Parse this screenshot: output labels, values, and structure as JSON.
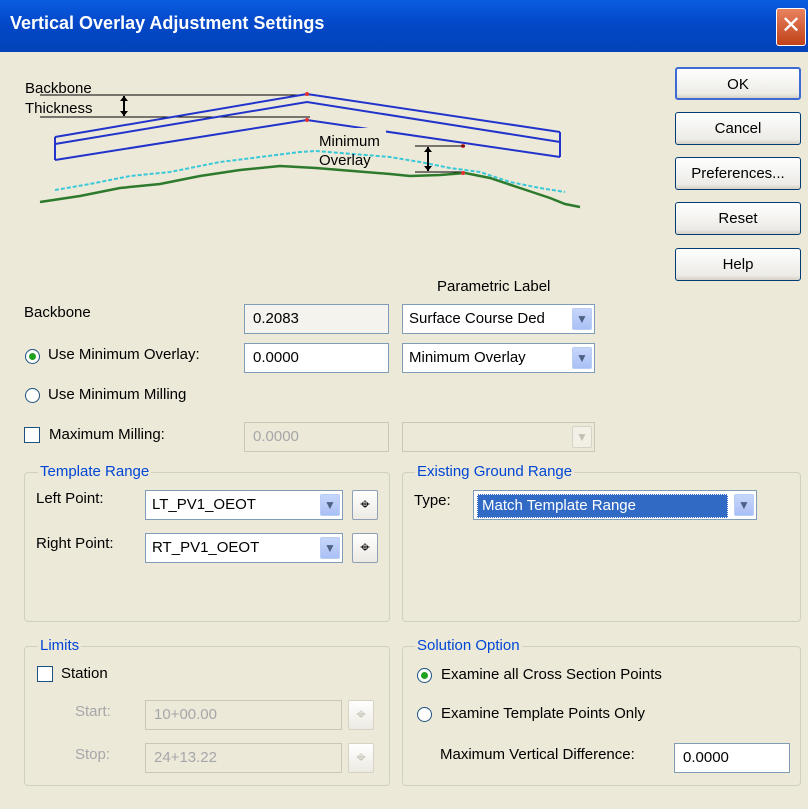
{
  "window": {
    "title": "Vertical Overlay Adjustment Settings",
    "close_glyph": "✕"
  },
  "buttons": {
    "ok": "OK",
    "cancel": "Cancel",
    "preferences": "Preferences...",
    "reset": "Reset",
    "help": "Help"
  },
  "diagram": {
    "backbone_label_1": "Backbone",
    "backbone_label_2": "Thickness",
    "min_overlay_label_1": "Minimum",
    "min_overlay_label_2": "Overlay"
  },
  "parametric_label_header": "Parametric Label",
  "backbone": {
    "label": "Backbone",
    "value": "0.2083",
    "parametric": "Surface Course Ded"
  },
  "min_overlay": {
    "label": "Use Minimum Overlay:",
    "value": "0.0000",
    "parametric": "Minimum Overlay",
    "selected": true
  },
  "min_milling": {
    "label": "Use Minimum Milling",
    "selected": false
  },
  "max_milling": {
    "label": "Maximum Milling:",
    "value": "0.0000",
    "checked": false
  },
  "template_range": {
    "title": "Template Range",
    "left_label": "Left Point:",
    "left_value": "LT_PV1_OEOT",
    "right_label": "Right Point:",
    "right_value": "RT_PV1_OEOT"
  },
  "existing_ground_range": {
    "title": "Existing Ground Range",
    "type_label": "Type:",
    "type_value": "Match Template Range"
  },
  "limits": {
    "title": "Limits",
    "station_label": "Station",
    "start_label": "Start:",
    "start_value": "10+00.00",
    "stop_label": "Stop:",
    "stop_value": "24+13.22"
  },
  "solution_option": {
    "title": "Solution Option",
    "opt1": "Examine all Cross Section Points",
    "opt2": "Examine Template Points Only",
    "max_diff_label": "Maximum Vertical Difference:",
    "max_diff_value": "0.0000"
  },
  "icons": {
    "dropdown": "▼",
    "pick": "⌖"
  }
}
